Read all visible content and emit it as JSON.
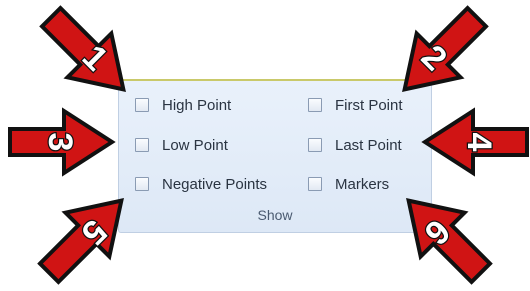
{
  "group": {
    "label": "Show",
    "options": [
      {
        "label": "High Point",
        "checked": false
      },
      {
        "label": "First Point",
        "checked": false
      },
      {
        "label": "Low Point",
        "checked": false
      },
      {
        "label": "Last Point",
        "checked": false
      },
      {
        "label": "Negative Points",
        "checked": false
      },
      {
        "label": "Markers",
        "checked": false
      }
    ]
  },
  "callouts": [
    "1",
    "2",
    "3",
    "4",
    "5",
    "6"
  ],
  "colors": {
    "arrow_fill": "#d01414",
    "arrow_outline": "#111111",
    "number": "#ffffff"
  }
}
